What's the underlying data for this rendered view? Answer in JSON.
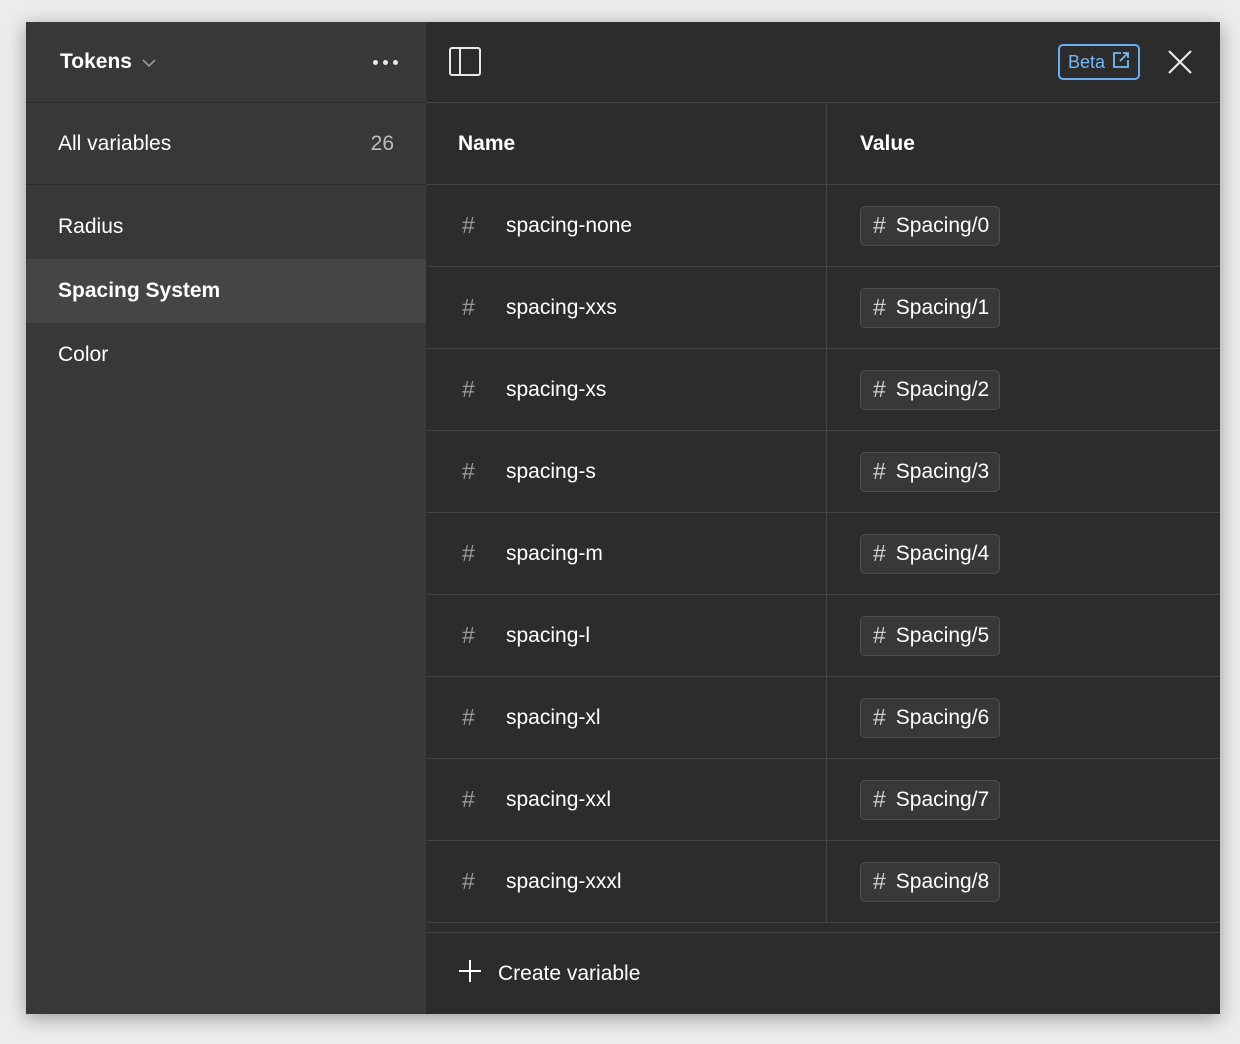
{
  "sidebar": {
    "collection_title": "Tokens",
    "all_variables": {
      "label": "All variables",
      "count": "26"
    },
    "groups": [
      {
        "label": "Radius"
      },
      {
        "label": "Spacing System"
      },
      {
        "label": "Color"
      }
    ]
  },
  "toolbar": {
    "beta_label": "Beta"
  },
  "table": {
    "columns": {
      "name": "Name",
      "value": "Value"
    },
    "rows": [
      {
        "name": "spacing-none",
        "value": "Spacing/0"
      },
      {
        "name": "spacing-xxs",
        "value": "Spacing/1"
      },
      {
        "name": "spacing-xs",
        "value": "Spacing/2"
      },
      {
        "name": "spacing-s",
        "value": "Spacing/3"
      },
      {
        "name": "spacing-m",
        "value": "Spacing/4"
      },
      {
        "name": "spacing-l",
        "value": "Spacing/5"
      },
      {
        "name": "spacing-xl",
        "value": "Spacing/6"
      },
      {
        "name": "spacing-xxl",
        "value": "Spacing/7"
      },
      {
        "name": "spacing-xxxl",
        "value": "Spacing/8"
      }
    ]
  },
  "footer": {
    "create_label": "Create variable"
  },
  "icons": {
    "variable_type": "number-hash-icon",
    "panel": "sidebar-panel-icon",
    "more": "more-horizontal-icon",
    "close": "close-icon",
    "external": "external-link-icon",
    "add": "plus-icon",
    "chevron": "chevron-down-icon"
  },
  "colors": {
    "accent": "#78b8f5",
    "background": "#2c2c2c",
    "sidebar": "#383838"
  }
}
